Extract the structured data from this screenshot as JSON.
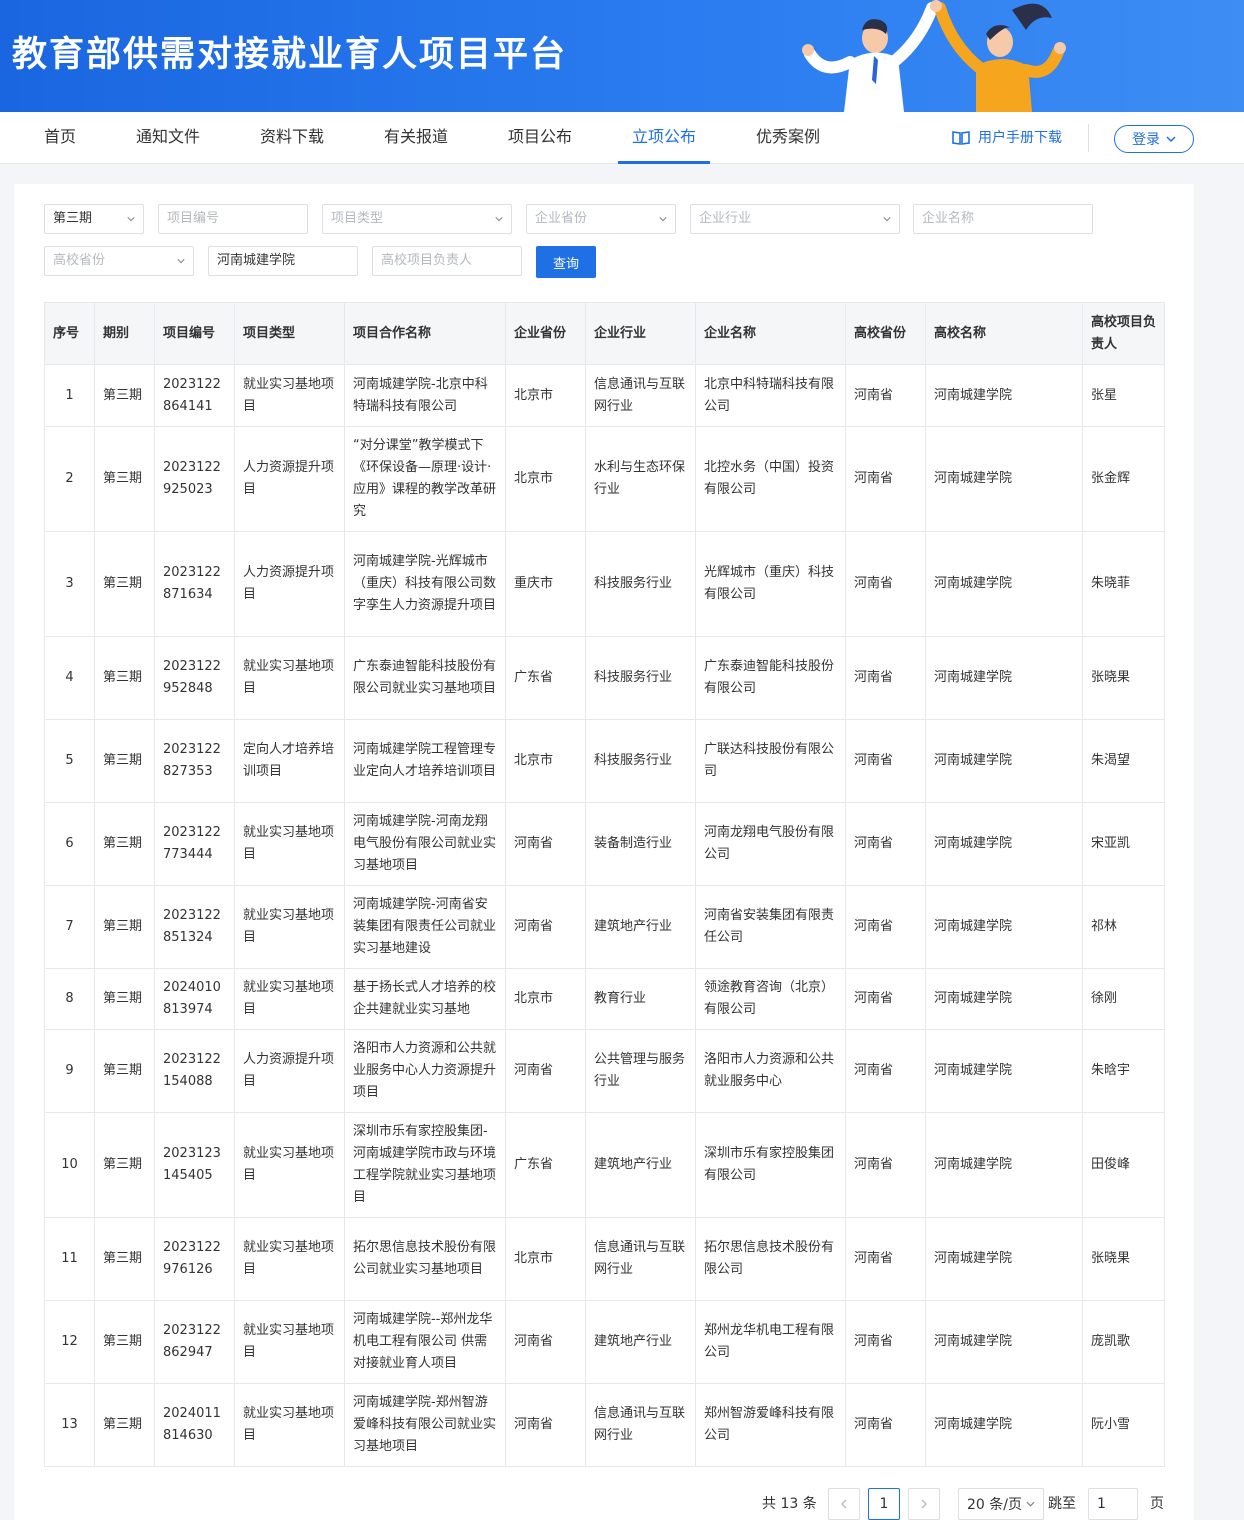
{
  "header": {
    "title": "教育部供需对接就业育人项目平台"
  },
  "nav": {
    "items": [
      {
        "label": "首页"
      },
      {
        "label": "通知文件"
      },
      {
        "label": "资料下载"
      },
      {
        "label": "有关报道"
      },
      {
        "label": "项目公布"
      },
      {
        "label": "立项公布"
      },
      {
        "label": "优秀案例"
      }
    ],
    "active_index": 5,
    "manual_label": "用户手册下载",
    "login_label": "登录"
  },
  "filters": {
    "period": "第三期",
    "project_no_placeholder": "项目编号",
    "project_type_placeholder": "项目类型",
    "company_province_placeholder": "企业省份",
    "company_industry_placeholder": "企业行业",
    "company_name_placeholder": "企业名称",
    "school_province_placeholder": "高校省份",
    "school_name_value": "河南城建学院",
    "school_lead_placeholder": "高校项目负责人",
    "query_label": "查询"
  },
  "table": {
    "headers": [
      "序号",
      "期别",
      "项目编号",
      "项目类型",
      "项目合作名称",
      "企业省份",
      "企业行业",
      "企业名称",
      "高校省份",
      "高校名称",
      "高校项目负责人"
    ],
    "rows": [
      [
        "1",
        "第三期",
        "2023122864141",
        "就业实习基地项目",
        "河南城建学院-北京中科特瑞科技有限公司",
        "北京市",
        "信息通讯与互联网行业",
        "北京中科特瑞科技有限公司",
        "河南省",
        "河南城建学院",
        "张星"
      ],
      [
        "2",
        "第三期",
        "2023122925023",
        "人力资源提升项目",
        "“对分课堂”教学模式下《环保设备—原理·设计·应用》课程的教学改革研究",
        "北京市",
        "水利与生态环保行业",
        "北控水务（中国）投资有限公司",
        "河南省",
        "河南城建学院",
        "张金辉"
      ],
      [
        "3",
        "第三期",
        "2023122871634",
        "人力资源提升项目",
        "河南城建学院-光辉城市（重庆）科技有限公司数字孪生人力资源提升项目",
        "重庆市",
        "科技服务行业",
        "光辉城市（重庆）科技有限公司",
        "河南省",
        "河南城建学院",
        "朱晓菲"
      ],
      [
        "4",
        "第三期",
        "2023122952848",
        "就业实习基地项目",
        "广东泰迪智能科技股份有限公司就业实习基地项目",
        "广东省",
        "科技服务行业",
        "广东泰迪智能科技股份有限公司",
        "河南省",
        "河南城建学院",
        "张晓果"
      ],
      [
        "5",
        "第三期",
        "2023122827353",
        "定向人才培养培训项目",
        "河南城建学院工程管理专业定向人才培养培训项目",
        "北京市",
        "科技服务行业",
        "广联达科技股份有限公司",
        "河南省",
        "河南城建学院",
        "朱渴望"
      ],
      [
        "6",
        "第三期",
        "2023122773444",
        "就业实习基地项目",
        "河南城建学院-河南龙翔电气股份有限公司就业实习基地项目",
        "河南省",
        "装备制造行业",
        "河南龙翔电气股份有限公司",
        "河南省",
        "河南城建学院",
        "宋亚凯"
      ],
      [
        "7",
        "第三期",
        "2023122851324",
        "就业实习基地项目",
        "河南城建学院-河南省安装集团有限责任公司就业实习基地建设",
        "河南省",
        "建筑地产行业",
        "河南省安装集团有限责任公司",
        "河南省",
        "河南城建学院",
        "祁林"
      ],
      [
        "8",
        "第三期",
        "2024010813974",
        "就业实习基地项目",
        "基于扬长式人才培养的校企共建就业实习基地",
        "北京市",
        "教育行业",
        "领途教育咨询（北京）有限公司",
        "河南省",
        "河南城建学院",
        "徐刚"
      ],
      [
        "9",
        "第三期",
        "2023122154088",
        "人力资源提升项目",
        "洛阳市人力资源和公共就业服务中心人力资源提升项目",
        "河南省",
        "公共管理与服务行业",
        "洛阳市人力资源和公共就业服务中心",
        "河南省",
        "河南城建学院",
        "朱晗宇"
      ],
      [
        "10",
        "第三期",
        "2023123145405",
        "就业实习基地项目",
        "深圳市乐有家控股集团-河南城建学院市政与环境工程学院就业实习基地项目",
        "广东省",
        "建筑地产行业",
        "深圳市乐有家控股集团有限公司",
        "河南省",
        "河南城建学院",
        "田俊峰"
      ],
      [
        "11",
        "第三期",
        "2023122976126",
        "就业实习基地项目",
        "拓尔思信息技术股份有限公司就业实习基地项目",
        "北京市",
        "信息通讯与互联网行业",
        "拓尔思信息技术股份有限公司",
        "河南省",
        "河南城建学院",
        "张晓果"
      ],
      [
        "12",
        "第三期",
        "2023122862947",
        "就业实习基地项目",
        "河南城建学院--郑州龙华机电工程有限公司 供需对接就业育人项目",
        "河南省",
        "建筑地产行业",
        "郑州龙华机电工程有限公司",
        "河南省",
        "河南城建学院",
        "庞凯歌"
      ],
      [
        "13",
        "第三期",
        "2024011814630",
        "就业实习基地项目",
        "河南城建学院-郑州智游爱峰科技有限公司就业实习基地项目",
        "河南省",
        "信息通讯与互联网行业",
        "郑州智游爱峰科技有限公司",
        "河南省",
        "河南城建学院",
        "阮小雪"
      ]
    ]
  },
  "pagination": {
    "total_label": "共 13 条",
    "current_page": "1",
    "page_size_label": "20 条/页",
    "jump_label": "跳至",
    "jump_value": "1",
    "page_suffix": "页"
  },
  "colors": {
    "accent": "#1f6fe5",
    "banner": "#2a7cf0"
  }
}
